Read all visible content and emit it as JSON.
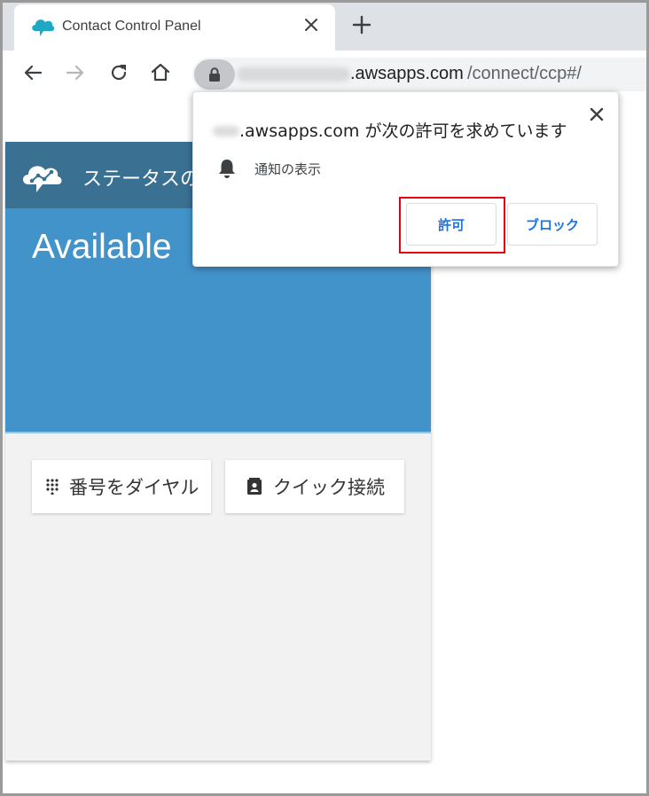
{
  "browser": {
    "tab": {
      "title": "Contact Control Panel",
      "favicon": "aws-connect-cloud-icon"
    },
    "toolbar": {
      "url_host": ".awsapps.com",
      "url_path": "/connect/ccp#/"
    }
  },
  "ccp": {
    "header_text": "ステータスの",
    "status": "Available",
    "buttons": {
      "dial": "番号をダイヤル",
      "quick_connect": "クイック接続"
    }
  },
  "permission_popup": {
    "title": ".awsapps.com が次の許可を求めています",
    "permission": "通知の表示",
    "allow_label": "許可",
    "block_label": "ブロック"
  },
  "colors": {
    "ccp_header": "#3a7091",
    "ccp_status": "#4293ca",
    "link_blue": "#1a73e8",
    "highlight_red": "#e60012"
  }
}
